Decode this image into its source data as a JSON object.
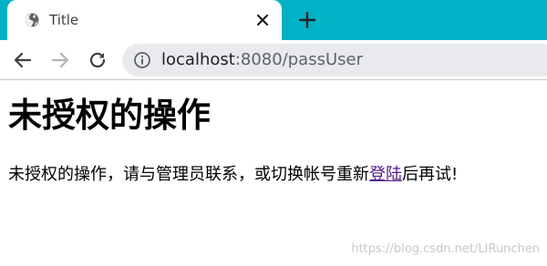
{
  "browser": {
    "tab": {
      "title": "Title",
      "favicon_icon": "globe-icon",
      "close_icon": "close-icon"
    },
    "new_tab_icon": "plus-icon",
    "nav": {
      "back_icon": "arrow-left-icon",
      "forward_icon": "arrow-right-icon",
      "reload_icon": "reload-icon"
    },
    "address_bar": {
      "info_icon": "info-icon",
      "host": "localhost",
      "rest": ":8080/passUser"
    },
    "colors": {
      "tab_strip": "#00b3c4",
      "omnibox": "#e8eaed"
    }
  },
  "page": {
    "heading": "未授权的操作",
    "message_before": "未授权的操作，请与管理员联系，或切换帐号重新",
    "link_text": "登陆",
    "message_after": "后再试!",
    "link_color": "#551a8b"
  },
  "watermark": "https://blog.csdn.net/LIRunchen"
}
